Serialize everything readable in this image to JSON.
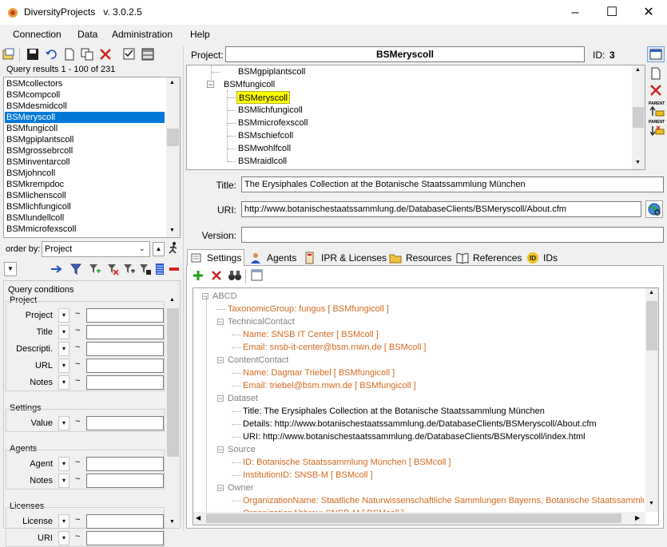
{
  "window": {
    "title": "DiversityProjects",
    "version": "v. 3.0.2.5",
    "minimize": "–",
    "maximize": "☐",
    "close": "✕"
  },
  "menu": [
    "Connection",
    "Data",
    "Administration",
    "Help"
  ],
  "left": {
    "query_results_label": "Query results",
    "query_results_count": "1 - 100 of 231",
    "results": [
      "BSMcollectors",
      "BSMcompcoll",
      "BSMdesmidcoll",
      "BSMeryscoll",
      "BSMfungicoll",
      "BSMgpiplantscoll",
      "BSMgrossebrcoll",
      "BSMinventarcoll",
      "BSMjohncoll",
      "BSMkrempdoc",
      "BSMlichenscoll",
      "BSMlichfungicoll",
      "BSMlundellcoll",
      "BSMmicrofexscoll"
    ],
    "selected_index": 3,
    "order_by_label": "order by:",
    "order_by_value": "Project",
    "query_conditions_label": "Query conditions",
    "groups": [
      {
        "title": "Project",
        "fields": [
          "Project",
          "Title",
          "Descripti.",
          "URL",
          "Notes"
        ]
      },
      {
        "title": "Settings",
        "fields": [
          "Value"
        ]
      },
      {
        "title": "Agents",
        "fields": [
          "Agent",
          "Notes"
        ]
      },
      {
        "title": "Licenses",
        "fields": [
          "License",
          "URI"
        ]
      }
    ],
    "tilde": "~"
  },
  "header": {
    "project_label": "Project:",
    "project_value": "BSMeryscoll",
    "id_label": "ID:",
    "id_value": "3"
  },
  "hierarchy": {
    "items": [
      {
        "text": "BSMgpiplantscoll",
        "level": 2
      },
      {
        "text": "BSMfungicoll",
        "level": 1,
        "expander": "−"
      },
      {
        "text": "BSMeryscoll",
        "level": 2,
        "highlight": true
      },
      {
        "text": "BSMlichfungicoll",
        "level": 2
      },
      {
        "text": "BSMmicrofexscoll",
        "level": 2
      },
      {
        "text": "BSMschiefcoll",
        "level": 2
      },
      {
        "text": "BSMwohlfcoll",
        "level": 2
      },
      {
        "text": "BSMraidlcoll",
        "level": 2
      }
    ]
  },
  "details": {
    "title_label": "Title:",
    "title_value": "The Erysiphales Collection at the Botanische Staatssammlung München",
    "uri_label": "URI:",
    "uri_value": "http://www.botanischestaatssammlung.de/DatabaseClients/BSMeryscoll/About.cfm",
    "version_label": "Version:",
    "version_value": ""
  },
  "tabs": [
    "Settings",
    "Agents",
    "IPR & Licenses",
    "Resources",
    "References",
    "IDs"
  ],
  "active_tab": 0,
  "settings_tree": [
    {
      "text": "ABCD",
      "level": 0,
      "style": "gray",
      "expander": "−"
    },
    {
      "text": "TaxonomicGroup: fungus    [ BSMfungicoll ]",
      "level": 1,
      "style": "orange"
    },
    {
      "text": "TechnicalContact",
      "level": 1,
      "style": "gray",
      "expander": "−"
    },
    {
      "text": "Name: SNSB IT Center    [ BSMcoll ]",
      "level": 2,
      "style": "orange"
    },
    {
      "text": "Email: snsb-it-center@bsm.mwn.de    [ BSMcoll ]",
      "level": 2,
      "style": "orange"
    },
    {
      "text": "ContentContact",
      "level": 1,
      "style": "gray",
      "expander": "−"
    },
    {
      "text": "Name: Dagmar Triebel    [ BSMfungicoll ]",
      "level": 2,
      "style": "orange"
    },
    {
      "text": "Email: triebel@bsm.mwn.de    [ BSMfungicoll ]",
      "level": 2,
      "style": "orange"
    },
    {
      "text": "Dataset",
      "level": 1,
      "style": "gray",
      "expander": "−"
    },
    {
      "text": "Title: The Erysiphales Collection at the Botanische Staatssammlung München",
      "level": 2,
      "style": "black"
    },
    {
      "text": "Details: http://www.botanischestaatssammlung.de/DatabaseClients/BSMeryscoll/About.cfm",
      "level": 2,
      "style": "black"
    },
    {
      "text": "URI: http://www.botanischestaatssammlung.de/DatabaseClients/BSMeryscoll/index.html",
      "level": 2,
      "style": "black"
    },
    {
      "text": "Source",
      "level": 1,
      "style": "gray",
      "expander": "−"
    },
    {
      "text": "ID: Botanische Staatssammlung München    [ BSMcoll ]",
      "level": 2,
      "style": "orange"
    },
    {
      "text": "InstitutionID: SNSB-M    [ BSMcoll ]",
      "level": 2,
      "style": "orange"
    },
    {
      "text": "Owner",
      "level": 1,
      "style": "gray",
      "expander": "−"
    },
    {
      "text": "OrganizationName: Staatliche Naturwissenschaftliche Sammlungen Bayerns, Botanische Staatssammlung M",
      "level": 2,
      "style": "orange"
    },
    {
      "text": "OrganizationAbbrev: SNSB-M    [ BSMcoll ]",
      "level": 2,
      "style": "orange"
    }
  ],
  "side_toolbar": {
    "parent_label": "PARENT"
  }
}
